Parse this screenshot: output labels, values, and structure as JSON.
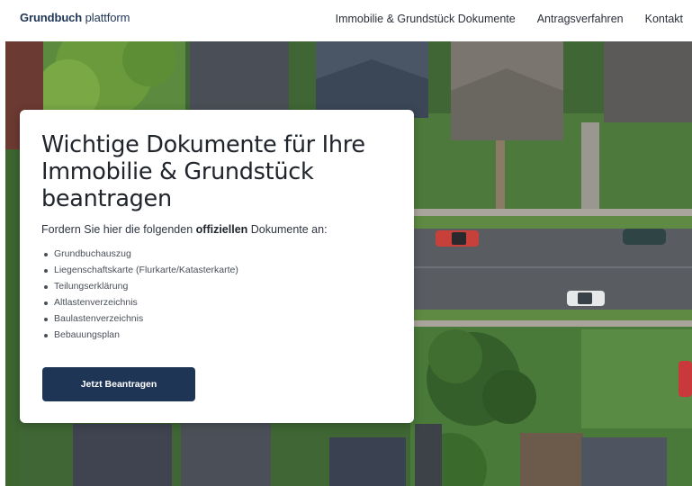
{
  "header": {
    "logo_strong": "Grundbuch",
    "logo_light": " plattform",
    "nav": [
      {
        "label": "Immobilie & Grundstück Dokumente"
      },
      {
        "label": "Antragsverfahren"
      },
      {
        "label": "Kontakt"
      }
    ]
  },
  "hero": {
    "title": "Wichtige Dokumente für Ihre Immobilie & Grundstück beantragen",
    "lead_prefix": "Fordern Sie hier die folgenden ",
    "lead_bold": "offiziellen",
    "lead_suffix": " Dokumente an:",
    "documents": [
      "Grundbuchauszug",
      "Liegenschaftskarte (Flurkarte/Katasterkarte)",
      "Teilungserklärung",
      "Altlastenverzeichnis",
      "Baulastenverzeichnis",
      "Bebauungsplan"
    ],
    "cta_label": "Jetzt Beantragen"
  },
  "colors": {
    "brand": "#1f3556",
    "card": "#ffffff",
    "lawn": "#4f7a3e"
  }
}
